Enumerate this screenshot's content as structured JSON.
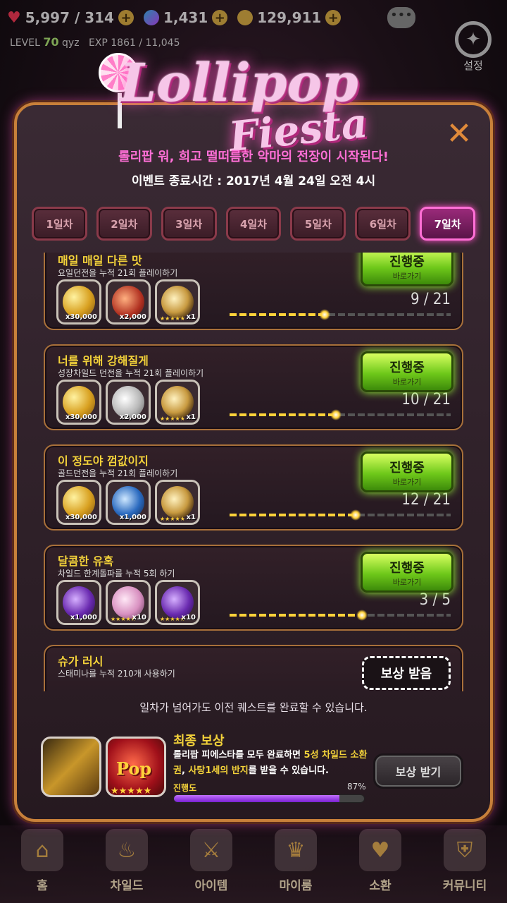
{
  "top_bar": {
    "hearts": "5,997 / 314",
    "gems": "1,431",
    "gold": "129,911",
    "level_label": "LEVEL",
    "level": "70",
    "player": "qyz",
    "exp": "EXP 1861 / 11,045"
  },
  "settings_label": "설정",
  "event": {
    "logo_line1": "Lollipop",
    "logo_line2": "Fiesta",
    "subtitle": "롤리팝 워, 희고 떨떠름한 악마의 전장이 시작된다!",
    "end_time": "이벤트 종료시간 : 2017년 4월 24일 오전 4시"
  },
  "tabs": [
    "1일차",
    "2일차",
    "3일차",
    "4일차",
    "5일차",
    "6일차",
    "7일차"
  ],
  "active_tab": 6,
  "quests": [
    {
      "title": "매일 매일 다른 맛",
      "desc": "요일던전을 누적 21회 플레이하기",
      "items": [
        {
          "icon": "gold-pile-icon",
          "count": "x30,000"
        },
        {
          "icon": "red-token-icon",
          "count": "x2,000"
        },
        {
          "icon": "ring-icon",
          "count": "x1"
        }
      ],
      "progress": 0.43,
      "count": "9 / 21",
      "button": {
        "main": "진행중",
        "sub": "바로가기"
      }
    },
    {
      "title": "너를 위해 강해질게",
      "desc": "성장차일드 던전을 누적 21회 플레이하기",
      "items": [
        {
          "icon": "gold-pile-icon",
          "count": "x30,000"
        },
        {
          "icon": "silver-coin-icon",
          "count": "x2,000"
        },
        {
          "icon": "ring-icon",
          "count": "x1"
        }
      ],
      "progress": 0.48,
      "count": "10 / 21",
      "button": {
        "main": "진행중",
        "sub": "바로가기"
      }
    },
    {
      "title": "이 정도야 껌값이지",
      "desc": "골드던전을 누적 21회 플레이하기",
      "items": [
        {
          "icon": "gold-pile-icon",
          "count": "x30,000"
        },
        {
          "icon": "blue-gear-icon",
          "count": "x1,000"
        },
        {
          "icon": "ring-icon",
          "count": "x1"
        }
      ],
      "progress": 0.57,
      "count": "12 / 21",
      "button": {
        "main": "진행중",
        "sub": "바로가기"
      }
    },
    {
      "title": "달콤한 유혹",
      "desc": "차일드 한계돌파를 누적 5회 하기",
      "items": [
        {
          "icon": "purple-gem-icon",
          "count": "x1,000"
        },
        {
          "icon": "pink-crystal-icon",
          "count": "x10"
        },
        {
          "icon": "purple-crystal-icon",
          "count": "x10"
        }
      ],
      "progress": 0.6,
      "count": "3 / 5",
      "button": {
        "main": "진행중",
        "sub": "바로가기"
      }
    },
    {
      "title": "슈가 러시",
      "desc": "스태미나를 누적 210개 사용하기",
      "button_claim": "보상 받음"
    }
  ],
  "note": "일차가 넘어가도 이전 퀘스트를 완료할 수 있습니다.",
  "final_reward": {
    "title": "최종 보상",
    "desc_a": "롤리팝 피에스타를 모두 완료하면 ",
    "desc_hl1": "5성 차일드 소환권",
    "desc_b": ", ",
    "desc_hl2": "사탕1세의 반지",
    "desc_c": "를 받을 수 있습니다.",
    "progress_label": "진행도",
    "progress_value": "87%",
    "progress": 0.87,
    "button": "보상 받기",
    "pop_text": "Pop"
  },
  "bottom_nav": [
    "홈",
    "차일드",
    "아이템",
    "마이룸",
    "소환",
    "커뮤니티"
  ]
}
